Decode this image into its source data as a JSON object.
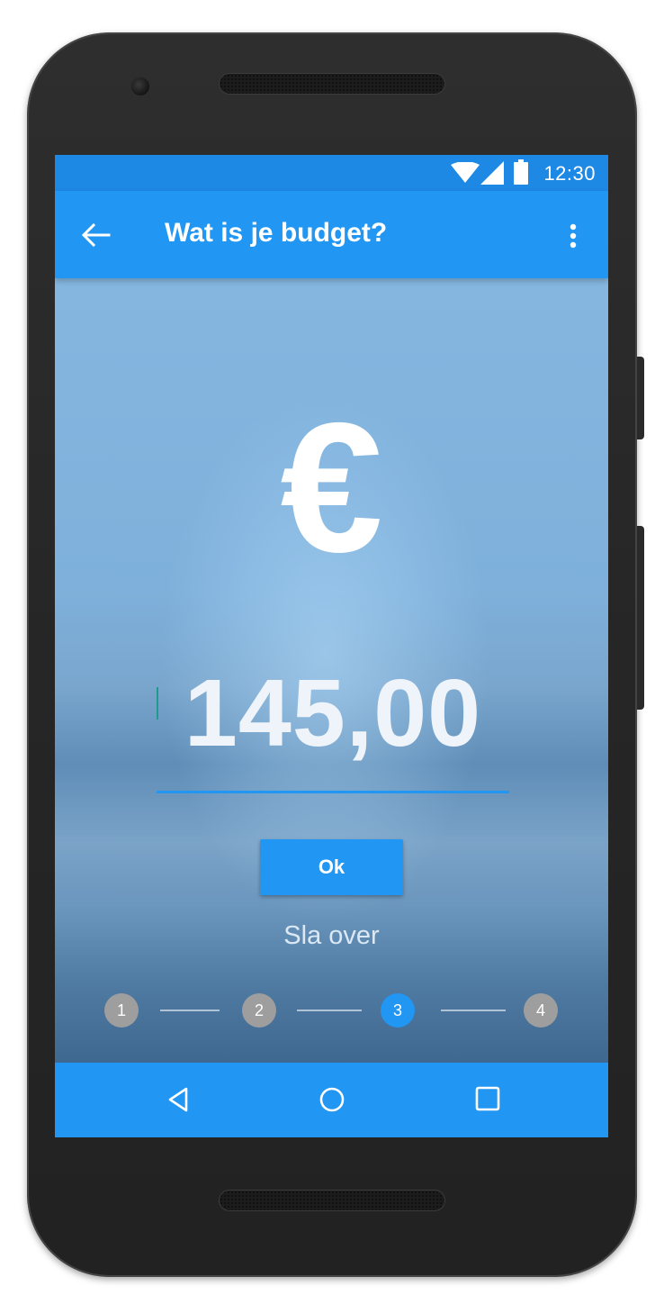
{
  "status_bar": {
    "time": "12:30",
    "icons": [
      "wifi-icon",
      "signal-icon",
      "battery-icon"
    ]
  },
  "app_bar": {
    "title": "Wat is je budget?",
    "back_icon": "arrow-left-icon",
    "menu_icon": "more-vert-icon"
  },
  "main": {
    "currency_symbol": "€",
    "amount": "145,00",
    "ok_label": "Ok",
    "skip_label": "Sla over"
  },
  "steps": {
    "items": [
      {
        "label": "1",
        "active": false
      },
      {
        "label": "2",
        "active": false
      },
      {
        "label": "3",
        "active": true
      },
      {
        "label": "4",
        "active": false
      }
    ]
  },
  "nav_bar": {
    "icons": [
      "back-triangle-icon",
      "home-circle-icon",
      "recents-square-icon"
    ]
  },
  "colors": {
    "primary": "#2196f3",
    "status_bar": "#1e88e5",
    "step_inactive": "#9e9e9e"
  }
}
